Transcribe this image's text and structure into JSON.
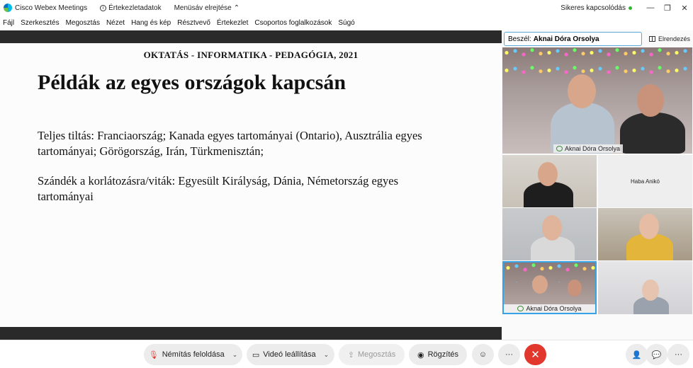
{
  "app": {
    "name": "Cisco Webex Meetings",
    "meeting_info": "Értekezletadatok",
    "hide_menu": "Menüsáv elrejtése",
    "status": "Sikeres kapcsolódás"
  },
  "menu": [
    "Fájl",
    "Szerkesztés",
    "Megosztás",
    "Nézet",
    "Hang és kép",
    "Résztvevő",
    "Értekezlet",
    "Csoportos foglalkozások",
    "Súgó"
  ],
  "slide": {
    "header": "OKTATÁS - INFORMATIKA - PEDAGÓGIA, 2021",
    "title": "Példák az egyes országok kapcsán",
    "paragraph1": "Teljes tiltás: Franciaország; Kanada egyes tartományai (Ontario), Ausztrália egyes tartományai; Görögország, Irán, Türkmenisztán;",
    "paragraph2": "Szándék a korlátozásra/viták: Egyesült Királyság, Dánia, Németország egyes tartományai"
  },
  "side_panel": {
    "speaker_label": "Beszél:",
    "speaker_name": "Aknai Dóra Orsolya",
    "layout_label": "Elrendezés",
    "main_tile_name": "Aknai Dóra Orsolya",
    "tile2_name": "Haba Anikó",
    "tile5_name": "Aknai Dóra Orsolya"
  },
  "controls": {
    "unmute": "Némítás feloldása",
    "stop_video": "Videó leállítása",
    "share": "Megosztás",
    "record": "Rögzítés"
  },
  "colors": {
    "accent": "#36a3e6",
    "end_call": "#e2372d",
    "status_ok": "#2eb82e"
  }
}
